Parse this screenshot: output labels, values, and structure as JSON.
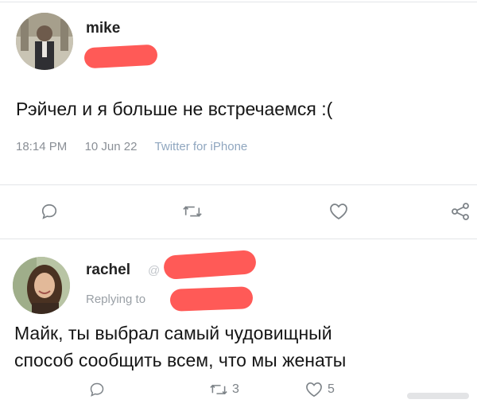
{
  "tweet": {
    "author": "mike",
    "text": "Рэйчел и я больше не встречаемся :(",
    "time": "18:14 PM",
    "date": "10 Jun 22",
    "client": "Twitter for iPhone"
  },
  "reply": {
    "author": "rachel",
    "handle_prefix": "@",
    "replying_to": "Replying to",
    "text_line1": "Майк, ты выбрал самый чудовищный",
    "text_line2": "способ сообщить всем, что мы женаты",
    "retweets": "3",
    "likes": "5"
  },
  "colors": {
    "redaction": "#ff5a57",
    "meta": "#8a8f96",
    "divider": "#e3e5e8"
  },
  "icons": [
    "reply-icon",
    "retweet-icon",
    "like-icon",
    "share-icon"
  ]
}
